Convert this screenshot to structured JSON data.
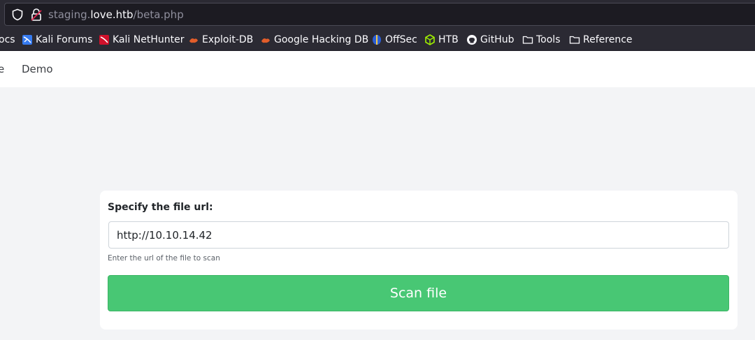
{
  "browser": {
    "url_prefix": "staging.",
    "url_domain": "love.htb",
    "url_path": "/beta.php"
  },
  "bookmarks": [
    {
      "label": "ocs",
      "icon": "docs-icon"
    },
    {
      "label": "Kali Forums",
      "icon": "kali-forums-icon"
    },
    {
      "label": "Kali NetHunter",
      "icon": "kali-nethunter-icon"
    },
    {
      "label": "Exploit-DB",
      "icon": "exploit-db-icon"
    },
    {
      "label": "Google Hacking DB",
      "icon": "google-hacking-db-icon"
    },
    {
      "label": "OffSec",
      "icon": "offsec-icon"
    },
    {
      "label": "HTB",
      "icon": "htb-icon"
    },
    {
      "label": "GitHub",
      "icon": "github-icon"
    },
    {
      "label": "Tools",
      "icon": "folder-icon"
    },
    {
      "label": "Reference",
      "icon": "folder-icon"
    }
  ],
  "nav": {
    "partial_item": "e",
    "demo": "Demo"
  },
  "form": {
    "label": "Specify the file url:",
    "input_value": "http://10.10.14.42",
    "help": "Enter the url of the file to scan",
    "button": "Scan file"
  },
  "colors": {
    "button": "#48c774",
    "toolbar": "#2b2a33",
    "page_bg": "#f3f4f6"
  }
}
